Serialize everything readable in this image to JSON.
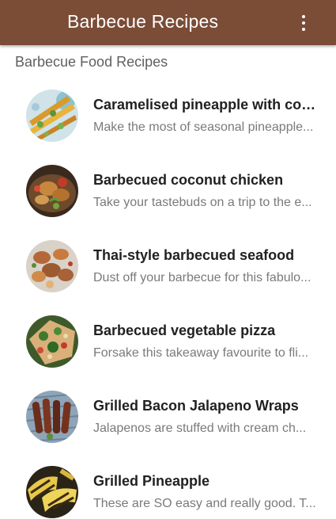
{
  "appbar": {
    "title": "Barbecue Recipes",
    "menu_icon": "more-vert-icon",
    "color": "#7b4c36"
  },
  "section": {
    "header": "Barbecue Food Recipes"
  },
  "recipes": [
    {
      "title": "Caramelised pineapple with coc...",
      "description": "Make the most of seasonal pineapple...",
      "image": "pineapple-skewers-photo"
    },
    {
      "title": "Barbecued coconut chicken",
      "description": "Take your tastebuds on a trip to the e...",
      "image": "coconut-chicken-photo"
    },
    {
      "title": "Thai-style barbecued seafood",
      "description": "Dust off your barbecue for this fabulo...",
      "image": "grilled-seafood-photo"
    },
    {
      "title": "Barbecued vegetable pizza",
      "description": "Forsake this takeaway favourite to fli...",
      "image": "vegetable-pizza-photo"
    },
    {
      "title": "Grilled Bacon Jalapeno Wraps",
      "description": "Jalapenos are stuffed with cream ch...",
      "image": "bacon-jalapeno-wraps-photo"
    },
    {
      "title": "Grilled Pineapple",
      "description": "These are SO easy and really good. T...",
      "image": "grilled-pineapple-photo"
    }
  ]
}
